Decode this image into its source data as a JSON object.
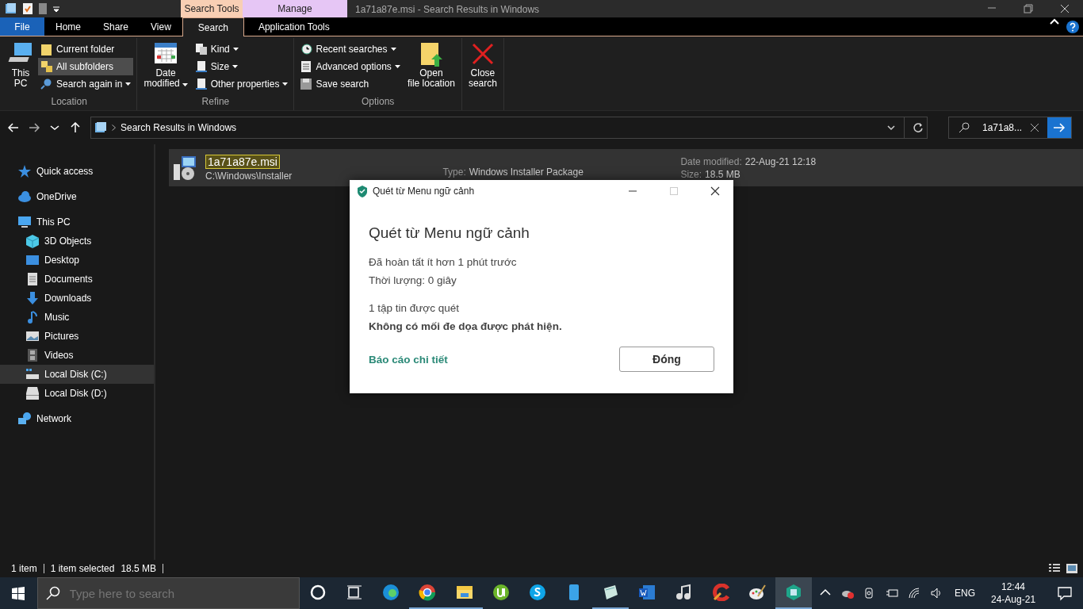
{
  "window": {
    "title": "1a71a87e.msi - Search Results in Windows",
    "context_tabs": [
      {
        "label": "Search Tools",
        "color": "#f8cfb4"
      },
      {
        "label": "Manage",
        "color": "#e6c6f5"
      }
    ]
  },
  "ribbon_tabs": [
    {
      "label": "File",
      "kind": "file",
      "selected": false
    },
    {
      "label": "Home",
      "kind": "tab",
      "selected": false
    },
    {
      "label": "Share",
      "kind": "tab",
      "selected": false
    },
    {
      "label": "View",
      "kind": "tab",
      "selected": false
    },
    {
      "label": "Search",
      "kind": "tab",
      "selected": true
    },
    {
      "label": "Application Tools",
      "kind": "tab",
      "selected": false
    }
  ],
  "ribbon_groups": [
    {
      "label": "Location",
      "items": [
        {
          "label": "This PC",
          "kind": "large",
          "dropdown": false,
          "selected": false
        },
        {
          "label": "Current folder",
          "kind": "small",
          "dropdown": false,
          "selected": false
        },
        {
          "label": "All subfolders",
          "kind": "small",
          "dropdown": false,
          "selected": true
        },
        {
          "label": "Search again in",
          "kind": "small",
          "dropdown": true,
          "selected": false
        }
      ]
    },
    {
      "label": "Refine",
      "items": [
        {
          "label": "Date modified",
          "kind": "large",
          "dropdown": true,
          "selected": false
        },
        {
          "label": "Kind",
          "kind": "small",
          "dropdown": true,
          "selected": false
        },
        {
          "label": "Size",
          "kind": "small",
          "dropdown": true,
          "selected": false
        },
        {
          "label": "Other properties",
          "kind": "small",
          "dropdown": true,
          "selected": false
        }
      ]
    },
    {
      "label": "Options",
      "items": [
        {
          "label": "Recent searches",
          "kind": "small",
          "dropdown": true,
          "selected": false
        },
        {
          "label": "Advanced options",
          "kind": "small",
          "dropdown": true,
          "selected": false
        },
        {
          "label": "Save search",
          "kind": "small",
          "dropdown": false,
          "selected": false
        },
        {
          "label": "Open file location",
          "kind": "large",
          "dropdown": false,
          "selected": false
        }
      ]
    },
    {
      "items": [
        {
          "label": "Close search",
          "kind": "large",
          "dropdown": false,
          "selected": false
        }
      ]
    }
  ],
  "address": {
    "path": "Search Results in Windows",
    "search_value": "1a71a8..."
  },
  "nav": [
    {
      "label": "Quick access",
      "selected": false
    },
    {
      "label": "OneDrive",
      "selected": false
    },
    {
      "label": "This PC",
      "selected": false,
      "children": [
        {
          "label": "3D Objects",
          "selected": false
        },
        {
          "label": "Desktop",
          "selected": false
        },
        {
          "label": "Documents",
          "selected": false
        },
        {
          "label": "Downloads",
          "selected": false
        },
        {
          "label": "Music",
          "selected": false
        },
        {
          "label": "Pictures",
          "selected": false
        },
        {
          "label": "Videos",
          "selected": false
        },
        {
          "label": "Local Disk (C:)",
          "selected": true
        },
        {
          "label": "Local Disk (D:)",
          "selected": false
        }
      ]
    },
    {
      "label": "Network",
      "selected": false
    }
  ],
  "results": [
    {
      "name": "1a71a87e.msi",
      "path": "C:\\Windows\\Installer",
      "type_label": "Type:",
      "type": "Windows Installer Package",
      "date_label": "Date modified:",
      "date": "22-Aug-21 12:18",
      "size_label": "Size:",
      "size": "18.5 MB",
      "selected": true
    }
  ],
  "status_bar": {
    "count": "1 item",
    "selection": "1 item selected",
    "selection_size": "18.5 MB"
  },
  "dialog": {
    "title": "Quét từ Menu ngữ cảnh",
    "heading": "Quét từ Menu ngữ cảnh",
    "lines": [
      "Đã hoàn tất ít hơn 1 phút trước",
      "Thời lượng: 0 giây"
    ],
    "scanned": "1 tập tin được quét",
    "result": "Không có mối đe dọa được phát hiện.",
    "link": "Báo cáo chi tiết",
    "button": "Đóng"
  },
  "taskbar": {
    "search_placeholder": "Type here to search",
    "apps": [
      {
        "running": false,
        "selected": false
      },
      {
        "running": false,
        "selected": false
      },
      {
        "running": false,
        "selected": false
      },
      {
        "running": true,
        "selected": false
      },
      {
        "running": true,
        "selected": false
      },
      {
        "running": false,
        "selected": false
      },
      {
        "running": false,
        "selected": false
      },
      {
        "running": false,
        "selected": false
      },
      {
        "running": true,
        "selected": false
      },
      {
        "running": false,
        "selected": false
      },
      {
        "running": false,
        "selected": false
      },
      {
        "running": false,
        "selected": false
      },
      {
        "running": false,
        "selected": false
      },
      {
        "running": true,
        "selected": true
      }
    ],
    "language": "ENG",
    "time": "12:44",
    "date": "24-Aug-21"
  }
}
